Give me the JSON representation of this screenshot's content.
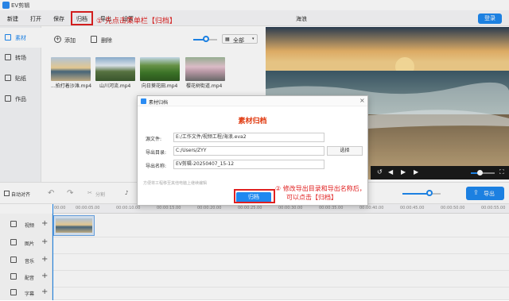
{
  "app": {
    "title": "EV剪辑"
  },
  "menu": {
    "items": [
      "新建",
      "打开",
      "保存",
      "归档",
      "导出",
      "设置"
    ],
    "doc_title": "海浪",
    "login": "登录"
  },
  "annotations": {
    "step1": "① 先点击菜单栏【归档】",
    "step2_line1": "② 修改导出目录和导出名称后，",
    "step2_line2": "可以点击【归档】"
  },
  "sidebar": {
    "items": [
      "素材",
      "转场",
      "贴纸",
      "作品"
    ]
  },
  "toolbar": {
    "add": "添加",
    "delete": "删除",
    "filter": "全部"
  },
  "materials": [
    {
      "name": "...拍打着沙滩.mp4"
    },
    {
      "name": "山川河流.mp4"
    },
    {
      "name": "向日葵花田.mp4"
    },
    {
      "name": "樱花树街道.mp4"
    }
  ],
  "player": {
    "zoom_level": 0.55
  },
  "timeline": {
    "auto_snap": "自动对齐",
    "split": "分割",
    "export": "导出",
    "ticks": [
      "00:00",
      "00:00:05.00",
      "00:00:10.00",
      "00:00:15.00",
      "00:00:20.00",
      "00:00:25.00",
      "00:00:30.00",
      "00:00:35.00",
      "00:00:40.00",
      "00:00:45.00",
      "00:00:50.00",
      "00:00:55.00"
    ],
    "tracks": [
      "视频",
      "图片",
      "音乐",
      "配音",
      "字幕"
    ]
  },
  "dialog": {
    "title": "素材归档",
    "heading": "素材归档",
    "source_label": "源文件:",
    "source_value": "E:/工作文件/视频工程/海浪.eva2",
    "dir_label": "导出目录:",
    "dir_value": "C:/Users/ZYY",
    "choose": "选择",
    "name_label": "导出名称:",
    "name_value": "EV剪辑-20250407_15-12",
    "hint": "方便将工程移至其他电脑上继续编辑",
    "archive_button": "归档"
  }
}
